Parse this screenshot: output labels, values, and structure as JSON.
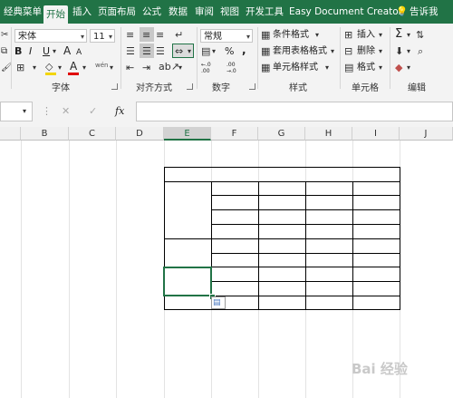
{
  "ribbon_tabs": [
    "经典菜单",
    "开始",
    "插入",
    "页面布局",
    "公式",
    "数据",
    "审阅",
    "视图",
    "开发工具",
    "Easy Document Creator"
  ],
  "active_tab": "开始",
  "tell_me": "告诉我",
  "font": {
    "name": "宋体",
    "size": "11",
    "bold": "B",
    "italic": "I",
    "underline": "U",
    "font_color_letter": "A",
    "grow": "A",
    "shrink": "A",
    "wen": "wén"
  },
  "number_format": "常规",
  "number_symbols": {
    "percent": "%",
    "comma": ",",
    "inc": "←.0 .00",
    "dec": ".00 →.0"
  },
  "styles": {
    "conditional": "条件格式",
    "table": "套用表格格式",
    "cell": "单元格样式"
  },
  "cells": {
    "insert": "插入",
    "delete": "删除",
    "format": "格式"
  },
  "editing": {
    "sum": "Σ"
  },
  "group_labels": {
    "font": "字体",
    "alignment": "对齐方式",
    "number": "数字",
    "styles": "样式",
    "cells": "单元格",
    "editing": "编辑"
  },
  "formula_bar": {
    "cancel": "✕",
    "enter": "✓",
    "fx": "fx"
  },
  "columns": [
    "B",
    "C",
    "D",
    "E",
    "F",
    "G",
    "H",
    "I",
    "J"
  ],
  "selected_column": "E",
  "watermark": "Bai 经验"
}
